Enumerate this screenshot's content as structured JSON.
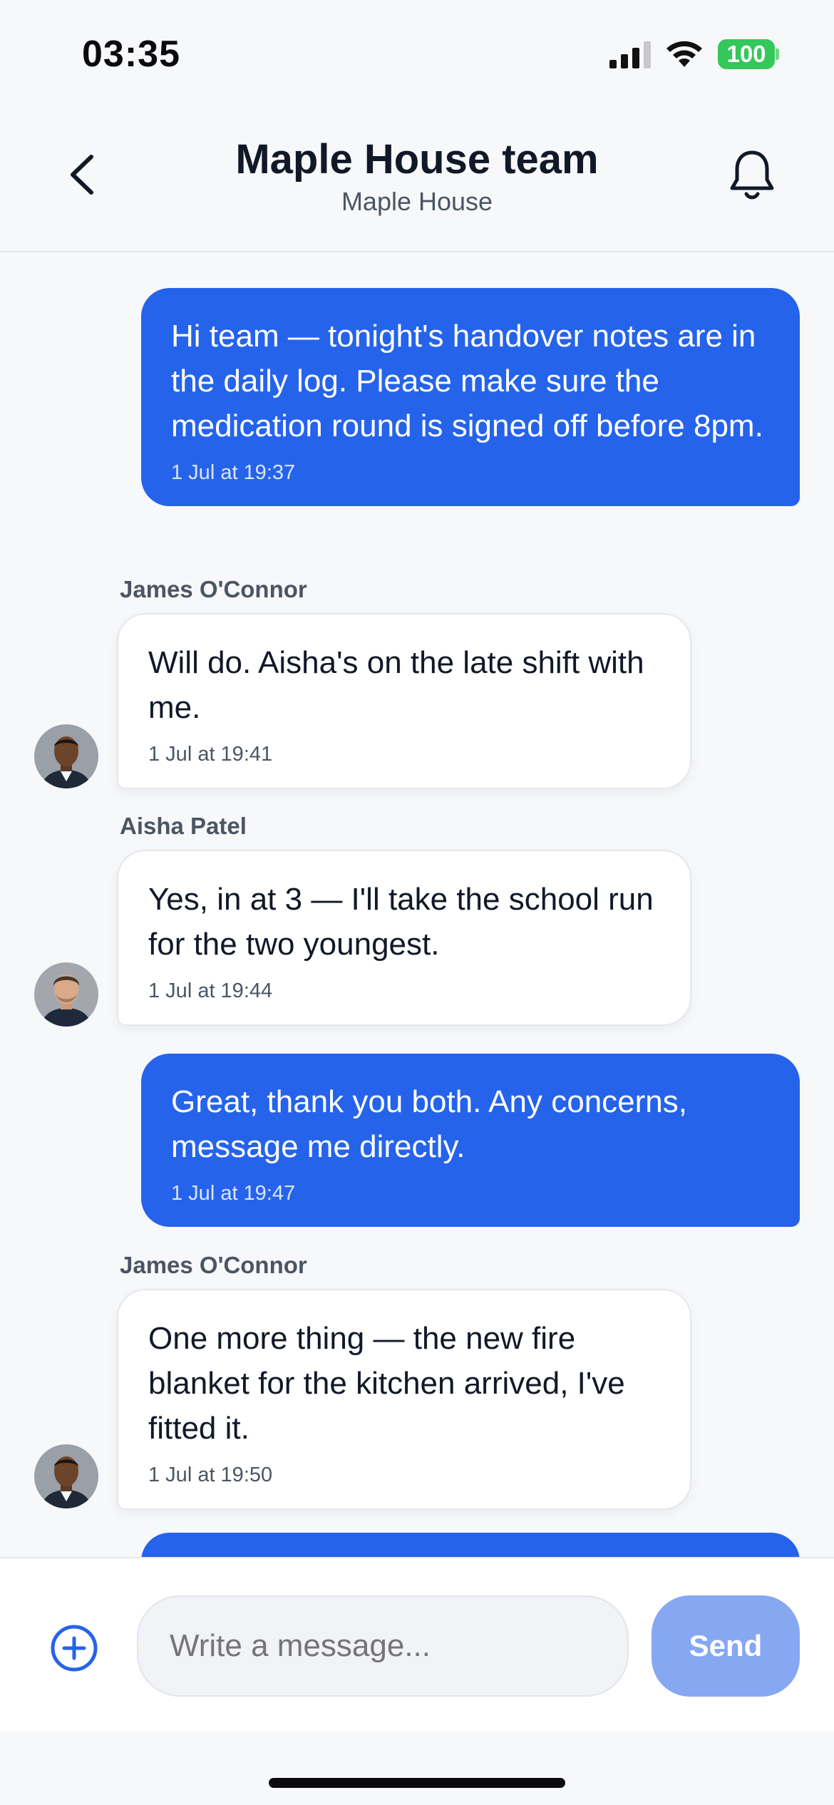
{
  "status_bar": {
    "time": "03:35",
    "battery": "100"
  },
  "header": {
    "title": "Maple House team",
    "subtitle": "Maple House"
  },
  "messages": [
    {
      "direction": "out",
      "text": "Hi team — tonight's handover notes are in the daily log. Please make sure the medication round is signed off before 8pm.",
      "time": "1 Jul at 19:37"
    },
    {
      "direction": "in",
      "sender": "James O'Connor",
      "text": "Will do. Aisha's on the late shift with me.",
      "time": "1 Jul at 19:41"
    },
    {
      "direction": "in",
      "sender": "Aisha Patel",
      "text": "Yes, in at 3 — I'll take the school run for the two youngest.",
      "time": "1 Jul at 19:44"
    },
    {
      "direction": "out",
      "text": "Great, thank you both. Any concerns, message me directly.",
      "time": "1 Jul at 19:47"
    },
    {
      "direction": "in",
      "sender": "James O'Connor",
      "text": "One more thing — the new fire blanket for the kitchen arrived, I've fitted it.",
      "time": "1 Jul at 19:50"
    }
  ],
  "composer": {
    "placeholder": "Write a message...",
    "send_label": "Send"
  },
  "colors": {
    "accent": "#2563eb",
    "send_disabled": "#86a7f2",
    "battery": "#34c759"
  }
}
